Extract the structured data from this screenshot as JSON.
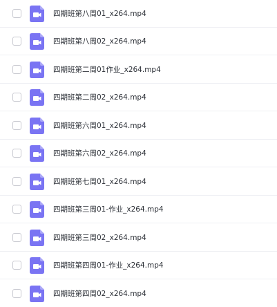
{
  "file_list": {
    "items": [
      {
        "name": "四期班第八周01_x264.mp4",
        "icon": "video-file-icon",
        "checked": false
      },
      {
        "name": "四期班第八周02_x264.mp4",
        "icon": "video-file-icon",
        "checked": false
      },
      {
        "name": "四期班第二周01作业_x264.mp4",
        "icon": "video-file-icon",
        "checked": false
      },
      {
        "name": "四期班第二周02_x264.mp4",
        "icon": "video-file-icon",
        "checked": false
      },
      {
        "name": "四期班第六周01_x264.mp4",
        "icon": "video-file-icon",
        "checked": false
      },
      {
        "name": "四期班第六周02_x264.mp4",
        "icon": "video-file-icon",
        "checked": false
      },
      {
        "name": "四期班第七周01_x264.mp4",
        "icon": "video-file-icon",
        "checked": false
      },
      {
        "name": "四期班第三周01-作业_x264.mp4",
        "icon": "video-file-icon",
        "checked": false
      },
      {
        "name": "四期班第三周02_x264.mp4",
        "icon": "video-file-icon",
        "checked": false
      },
      {
        "name": "四期班第四周01-作业_x264.mp4",
        "icon": "video-file-icon",
        "checked": false
      },
      {
        "name": "四期班第四周02_x264.mp4",
        "icon": "video-file-icon",
        "checked": false
      }
    ]
  },
  "colors": {
    "icon_purple": "#7a74f3",
    "icon_fold": "#aaa6f8",
    "text": "#2b2f36",
    "divider": "#eeeff3",
    "checkbox_border": "#c8c9d0"
  }
}
